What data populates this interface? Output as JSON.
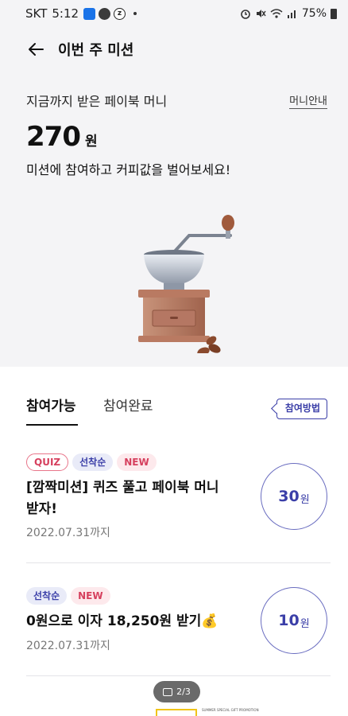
{
  "status_bar": {
    "carrier": "SKT",
    "time": "5:12",
    "battery": "75%",
    "app_icons": [
      "news-icon",
      "talk-icon",
      "z-icon"
    ]
  },
  "header": {
    "title": "이번 주 미션"
  },
  "summary": {
    "label": "지금까지 받은 페이북 머니",
    "guide_link": "머니안내",
    "amount": "270",
    "unit": "원",
    "description": "미션에 참여하고 커피값을 벌어보세요!"
  },
  "tabs": [
    {
      "label": "참여가능",
      "active": true
    },
    {
      "label": "참여완료",
      "active": false
    }
  ],
  "how_to_button": "참여방법",
  "missions": [
    {
      "badges": [
        "QUIZ",
        "선착순",
        "NEW"
      ],
      "title": "[깜짝미션] 퀴즈 풀고 페이북 머니 받자!",
      "date": "2022.07.31까지",
      "reward": "30",
      "reward_unit": "원"
    },
    {
      "badges": [
        "선착순",
        "NEW"
      ],
      "title": "0원으로 이자 18,250원 받기💰",
      "date": "2022.07.31까지",
      "reward": "10",
      "reward_unit": "원"
    }
  ],
  "pager": {
    "text": "2/3"
  },
  "peek_banner": {
    "text": "SUMMER SPECIAL GIFT PROMOTION"
  },
  "colors": {
    "accent": "#3b3fa8",
    "new_badge": "#d6405e",
    "hero_bg": "#f4f4f6"
  }
}
